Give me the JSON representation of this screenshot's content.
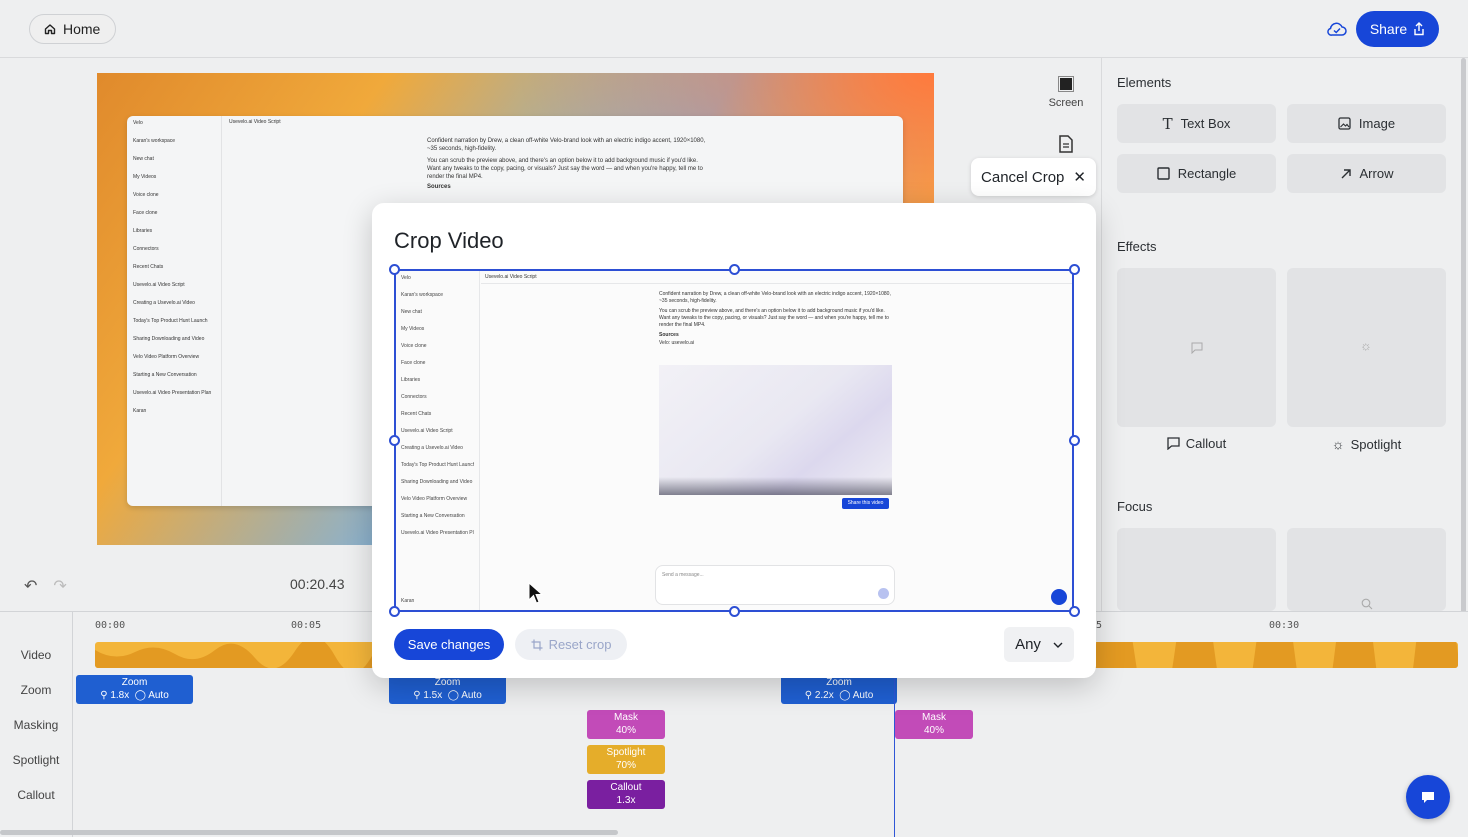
{
  "header": {
    "home_label": "Home",
    "share_label": "Share",
    "home_icon": "home-icon",
    "cloud_icon": "cloud-check-icon",
    "share_icon": "share-icon"
  },
  "canvas": {
    "window_title": "Usevelo.ai Video Script",
    "app_name": "Velo",
    "workspace": "Karan's workspace",
    "sidebar_items": [
      "New chat",
      "My Videos",
      "Voice clone",
      "Face clone",
      "Libraries",
      "Connectors",
      "Recent Chats",
      "Usevelo.ai Video Script",
      "Creating a Usevelo.ai Video",
      "Today's Top Product Hunt Launch",
      "Sharing Downloading and Video",
      "Velo Video Platform Overview",
      "Starting a New Conversation",
      "Usevelo.ai Video Presentation Plan"
    ],
    "user": "Karan",
    "paragraph_1": "Confident narration by Drew, a clean off-white Velo-brand look with an electric indigo accent, 1920×1080, ~35 seconds, high-fidelity.",
    "paragraph_2": "You can scrub the preview above, and there's an option below it to add background music if you'd like. Want any tweaks to the copy, pacing, or visuals? Just say the word — and when you're happy, tell me to render the final MP4.",
    "sources_label": "Sources",
    "source_item": "Velo: usevelo.ai",
    "share_video_label": "Share this video",
    "composer_placeholder": "Send a message...",
    "screen_tool_label": "Screen",
    "timecode": "00:20.43"
  },
  "crop_dialog": {
    "title": "Crop Video",
    "cancel_crop_label": "Cancel Crop",
    "save_label": "Save changes",
    "reset_label": "Reset crop",
    "aspect_value": "Any"
  },
  "right_panel": {
    "elements_heading": "Elements",
    "elements": [
      {
        "label": "Text Box",
        "icon": "text-icon"
      },
      {
        "label": "Image",
        "icon": "image-icon"
      },
      {
        "label": "Rectangle",
        "icon": "rectangle-icon"
      },
      {
        "label": "Arrow",
        "icon": "arrow-icon"
      }
    ],
    "effects_heading": "Effects",
    "effects": [
      {
        "label": "Callout",
        "icon": "callout-icon"
      },
      {
        "label": "Spotlight",
        "icon": "spotlight-icon"
      }
    ],
    "focus_heading": "Focus"
  },
  "timeline": {
    "track_labels": [
      "Video",
      "Zoom",
      "Masking",
      "Spotlight",
      "Callout"
    ],
    "ruler": [
      "00:00",
      "00:05",
      "00:30"
    ],
    "ruler_partial": "5",
    "zoom_clips": [
      {
        "title": "Zoom",
        "scale": "1.8x",
        "mode": "Auto"
      },
      {
        "title": "Zoom",
        "scale": "1.5x",
        "mode": "Auto"
      },
      {
        "title": "Zoom",
        "scale": "2.2x",
        "mode": "Auto"
      }
    ],
    "mask_clips": [
      {
        "title": "Mask",
        "value": "40%"
      },
      {
        "title": "Mask",
        "value": "40%"
      }
    ],
    "spotlight_clip": {
      "title": "Spotlight",
      "value": "70%"
    },
    "callout_clip": {
      "title": "Callout",
      "value": "1.3x"
    }
  },
  "colors": {
    "accent": "#1746d8",
    "zoom_clip": "#1f5fd1",
    "mask_clip": "#c24bb8",
    "spotlight_clip": "#e5ad2a",
    "callout_clip": "#7a1fa0",
    "video_track": "#f3b53a"
  }
}
